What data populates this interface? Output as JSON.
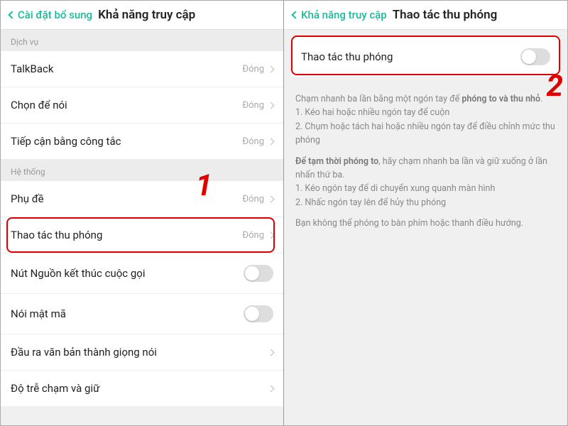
{
  "left": {
    "back_label": "Cài đặt bổ sung",
    "title": "Khả năng truy cập",
    "section_service": "Dịch vụ",
    "section_system": "Hệ thống",
    "rows": {
      "talkback": {
        "label": "TalkBack",
        "status": "Đóng"
      },
      "select_speak": {
        "label": "Chọn để nói",
        "status": "Đóng"
      },
      "switch_access": {
        "label": "Tiếp cận bằng công tắc",
        "status": "Đóng"
      },
      "captions": {
        "label": "Phụ đề",
        "status": "Đóng"
      },
      "magnification": {
        "label": "Thao tác thu phóng",
        "status": "Đóng"
      },
      "power_end_call": {
        "label": "Nút Nguồn kết thúc cuộc gọi"
      },
      "speak_password": {
        "label": "Nói mật mã"
      },
      "tts": {
        "label": "Đầu ra văn bản thành giọng nói"
      },
      "touch_delay": {
        "label": "Độ trễ chạm và giữ"
      }
    },
    "step_number": "1"
  },
  "right": {
    "back_label": "Khả năng truy cập",
    "title": "Thao tác thu phóng",
    "toggle_label": "Thao tác thu phóng",
    "step_number": "2",
    "desc": {
      "p1_a": "Chạm nhanh ba lần bằng một ngón tay để ",
      "p1_b": "phóng to và thu nhỏ",
      "p1_c": ".",
      "l1": "1. Kéo hai hoặc nhiều ngón tay để cuộn",
      "l2": "2. Chụm hoặc tách hai hoặc nhiều ngón tay để điều chỉnh mức thu phóng",
      "p2_a": "Để tạm thời phóng to",
      "p2_b": ", hãy chạm nhanh ba lần và giữ xuống ở lần nhấn thứ ba.",
      "l3": "1. Kéo ngón tay để di chuyển xung quanh màn hình",
      "l4": "2. Nhấc ngón tay lên để hủy thu phóng",
      "p3": "Bạn không thể phóng to bàn phím hoặc thanh điều hướng."
    }
  }
}
